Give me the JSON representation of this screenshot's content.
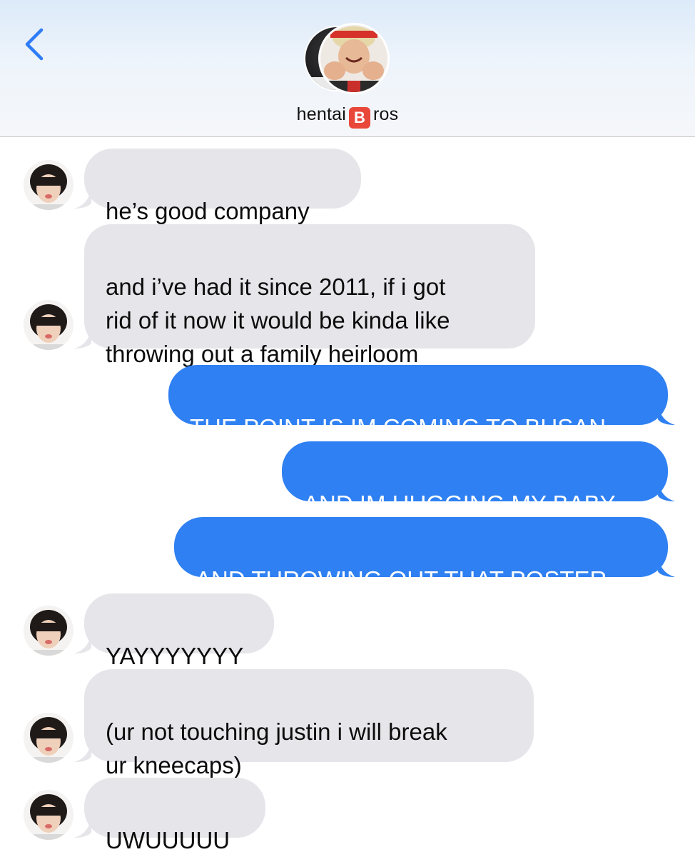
{
  "header": {
    "back_label": "",
    "group_name_pre": "hentai",
    "group_name_emoji": "B",
    "group_name_post": "ros"
  },
  "colors": {
    "incoming_bubble": "#e5e5ea",
    "outgoing_bubble": "#2f80f2",
    "accent": "#2f7cf6"
  },
  "messages": [
    {
      "direction": "incoming",
      "text": "he’s good company"
    },
    {
      "direction": "incoming",
      "text": "and i’ve had it since 2011, if i got\nrid of it now it would be kinda like\nthrowing out a family heirloom"
    },
    {
      "direction": "outgoing",
      "text": "THE POINT IS IM COMING TO BUSAN"
    },
    {
      "direction": "outgoing",
      "text": "AND IM HUGGING MY BABY"
    },
    {
      "direction": "outgoing",
      "text": "AND THROWING OUT THAT POSTER"
    },
    {
      "direction": "incoming",
      "text": "YAYYYYYYY"
    },
    {
      "direction": "incoming",
      "text": "(ur not touching justin i will break\nur kneecaps)"
    },
    {
      "direction": "incoming",
      "text": "UWUUUUU"
    }
  ]
}
